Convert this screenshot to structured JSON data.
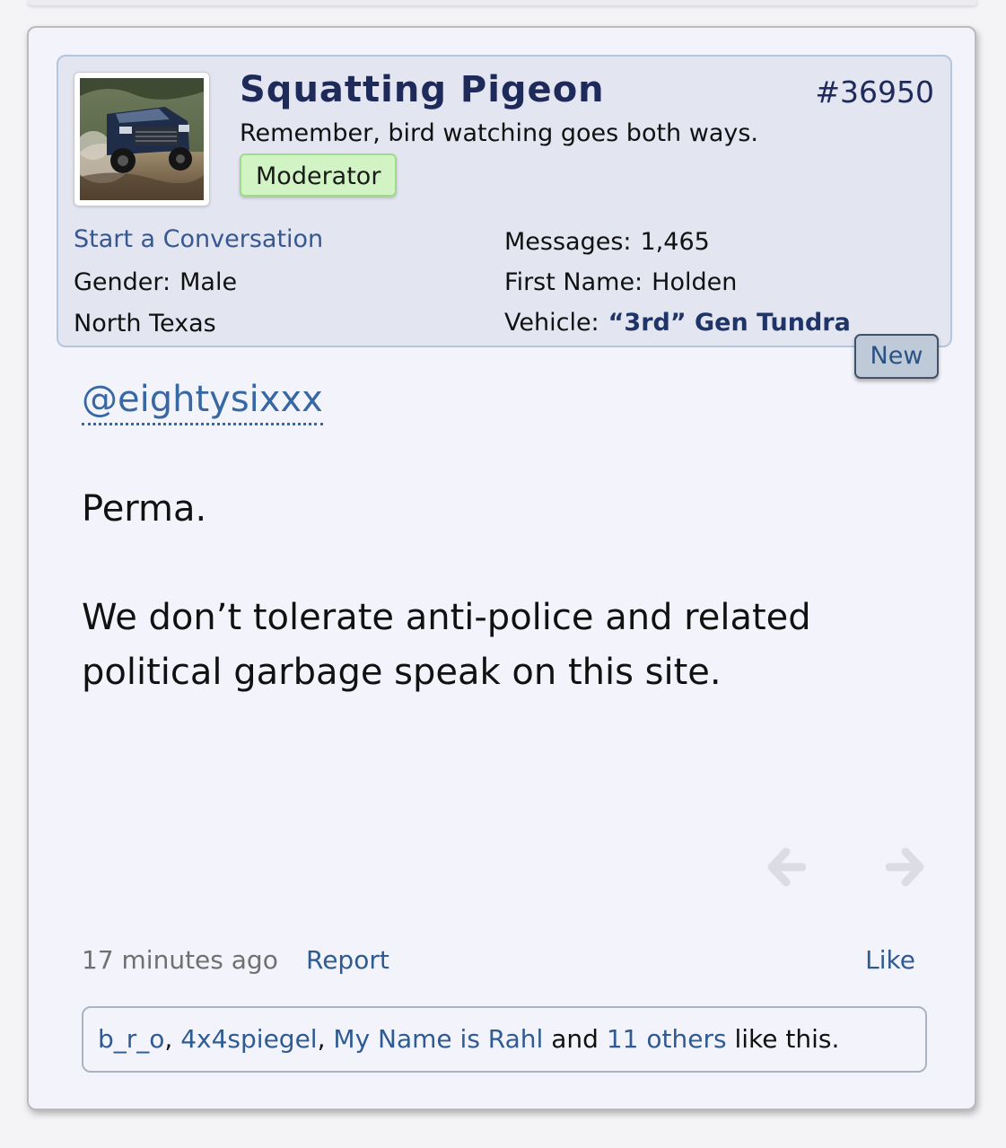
{
  "post": {
    "username": "Squatting Pigeon",
    "post_number": "#36950",
    "user_title": "Remember, bird watching goes both ways.",
    "role_badge": "Moderator",
    "start_conversation": "Start a Conversation",
    "gender_label": "Gender:",
    "gender_value": "Male",
    "location": "North Texas",
    "messages_label": "Messages:",
    "messages_value": "1,465",
    "first_name_label": "First Name:",
    "first_name_value": "Holden",
    "vehicle_label": "Vehicle:",
    "vehicle_value": "“3rd” Gen Tundra",
    "new_badge": "New",
    "mention": "@eightysixxx",
    "body": [
      "Perma.",
      "We don’t tolerate anti-police and related political garbage speak on this site."
    ],
    "time": "17 minutes ago",
    "report_label": "Report",
    "like_label": "Like",
    "likes": {
      "user1": "b_r_o",
      "sep1": ", ",
      "user2": "4x4spiegel",
      "sep2": ", ",
      "user3": "My Name is Rahl",
      "and": " and ",
      "others": "11 others",
      "suffix": " like this."
    }
  },
  "icons": {
    "avatar": "truck-photo",
    "prev": "arrow-left-icon",
    "next": "arrow-right-icon"
  }
}
